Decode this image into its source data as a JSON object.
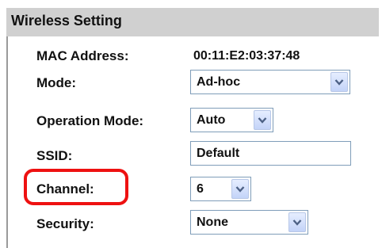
{
  "section": {
    "title": "Wireless Setting"
  },
  "mac_address": {
    "label": "MAC Address:",
    "value": "00:11:E2:03:37:48"
  },
  "mode": {
    "label": "Mode:",
    "selected": "Ad-hoc"
  },
  "operation_mode": {
    "label": "Operation Mode:",
    "selected": "Auto"
  },
  "ssid": {
    "label": "SSID:",
    "value": "Default"
  },
  "channel": {
    "label": "Channel:",
    "selected": "6"
  },
  "security": {
    "label": "Security:",
    "selected": "None"
  },
  "colors": {
    "header_background": "#d0d0d0",
    "field_border": "#7f9db9",
    "highlight": "#ee1111"
  },
  "icons": {
    "dropdown": "chevron-down-icon"
  }
}
